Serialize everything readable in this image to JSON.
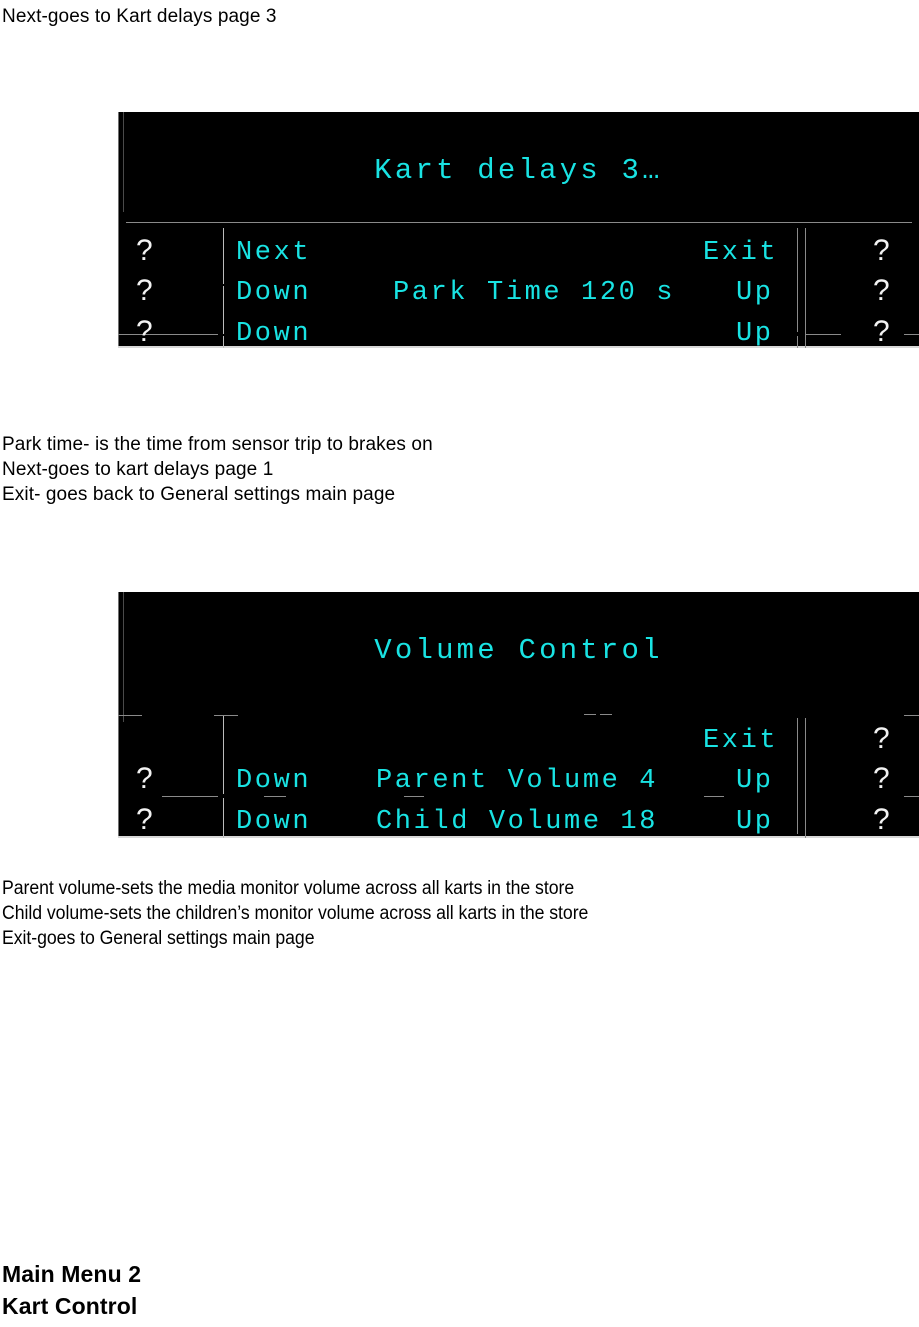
{
  "document": {
    "top_note": "Next-goes to Kart delays page 3",
    "notes_after_panel1": [
      "Park time- is the time from sensor trip to brakes on",
      "Next-goes to kart delays page 1",
      "Exit- goes back to General settings main page"
    ],
    "notes_after_panel2": [
      "Parent volume-sets the media monitor volume across all karts in the store",
      "Child volume-sets the children’s monitor volume across all karts in the store",
      "Exit-goes to General settings main page"
    ],
    "footer_lines": [
      "Main Menu 2",
      "Kart Control"
    ]
  },
  "colors": {
    "lcd_background": "#000000",
    "lcd_text": "#19e3e3",
    "lcd_marker": "#f2f2f2",
    "lcd_rule": "#8a8a8a",
    "page_text": "#000000"
  },
  "panel1": {
    "name": "kart-delays-3-screen",
    "title": "Kart delays 3…",
    "rows": [
      {
        "left_marker": "?",
        "left_button": "Next",
        "center": "",
        "right_button": "Exit",
        "right_marker": "?"
      },
      {
        "left_marker": "?",
        "left_button": "Down",
        "center": "Park Time 120 s",
        "right_button": "Up",
        "right_marker": "?"
      },
      {
        "left_marker": "?",
        "left_button": "Down",
        "center": "",
        "right_button": "Up",
        "right_marker": "?"
      }
    ]
  },
  "panel2": {
    "name": "volume-control-screen",
    "title": "Volume Control",
    "rows": [
      {
        "left_marker": "",
        "left_button": "",
        "center": "",
        "right_button": "Exit",
        "right_marker": "?"
      },
      {
        "left_marker": "?",
        "left_button": "Down",
        "center": "Parent Volume 4",
        "right_button": "Up",
        "right_marker": "?"
      },
      {
        "left_marker": "?",
        "left_button": "Down",
        "center": "Child Volume 18",
        "right_button": "Up",
        "right_marker": "?"
      }
    ]
  }
}
